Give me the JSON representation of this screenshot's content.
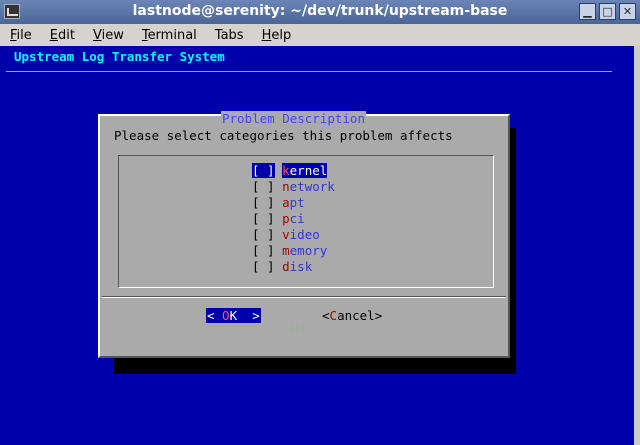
{
  "window": {
    "title": "lastnode@serenity: ~/dev/trunk/upstream-base",
    "minimize_glyph": "▁",
    "maximize_glyph": "□",
    "close_glyph": "✕"
  },
  "menu": {
    "items": [
      {
        "first": "F",
        "rest": "ile"
      },
      {
        "first": "E",
        "rest": "dit"
      },
      {
        "first": "V",
        "rest": "iew"
      },
      {
        "first": "T",
        "rest": "erminal"
      },
      {
        "first": "Ta",
        "rest": "bs",
        "u_index": 1
      },
      {
        "first": "H",
        "rest": "elp"
      }
    ]
  },
  "terminal": {
    "backtitle": "Upstream Log Transfer System"
  },
  "dialog": {
    "title": "Problem Description",
    "prompt": "Please select categories this problem affects",
    "items": [
      {
        "box": "[ ]",
        "hot": "k",
        "rest": "ernel",
        "selected": true
      },
      {
        "box": "[ ]",
        "hot": "n",
        "rest": "etwork",
        "selected": false
      },
      {
        "box": "[ ]",
        "hot": "a",
        "rest": "pt",
        "selected": false
      },
      {
        "box": "[ ]",
        "hot": "p",
        "rest": "ci",
        "selected": false
      },
      {
        "box": "[ ]",
        "hot": "v",
        "rest": "ideo",
        "selected": false
      },
      {
        "box": "[ ]",
        "hot": "m",
        "rest": "emory",
        "selected": false
      },
      {
        "box": "[ ]",
        "hot": "d",
        "rest": "isk",
        "selected": false
      }
    ],
    "scroll_indicator": "(+)",
    "ok_button": {
      "left": "<",
      "hot": " O",
      "rest": "K",
      "right": ">"
    },
    "cancel_button": {
      "left": "<",
      "hot": "C",
      "rest": "ancel",
      "right": ">"
    }
  }
}
